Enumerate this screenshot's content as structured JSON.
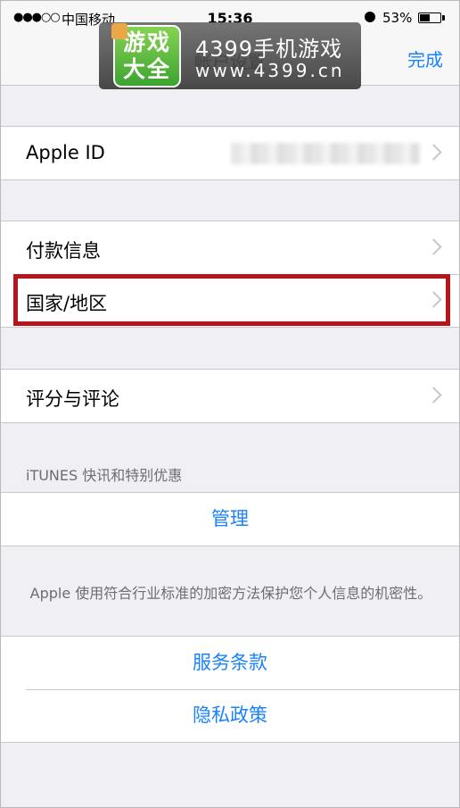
{
  "status": {
    "signal": "●●●○○",
    "carrier": "中国移动",
    "time": "15:36",
    "battery_percent": "53%",
    "battery_level": 0.53
  },
  "nav": {
    "title": "帐户设置",
    "done_label": "完成"
  },
  "watermark": {
    "logo_text": "游戏大全",
    "title": "4399手机游戏",
    "url": "www.4399.cn"
  },
  "settings": {
    "apple_id_label": "Apple ID",
    "payment_label": "付款信息",
    "country_label": "国家/地区",
    "ratings_label": "评分与评论"
  },
  "itunes": {
    "header": "iTUNES 快讯和特别优惠",
    "manage_label": "管理"
  },
  "footer": {
    "note": "Apple 使用符合行业标准的加密方法保护您个人信息的机密性。",
    "terms_label": "服务条款",
    "privacy_label": "隐私政策"
  },
  "colors": {
    "accent": "#1a82fb",
    "highlight": "#b8141b",
    "background": "#efeff4"
  }
}
